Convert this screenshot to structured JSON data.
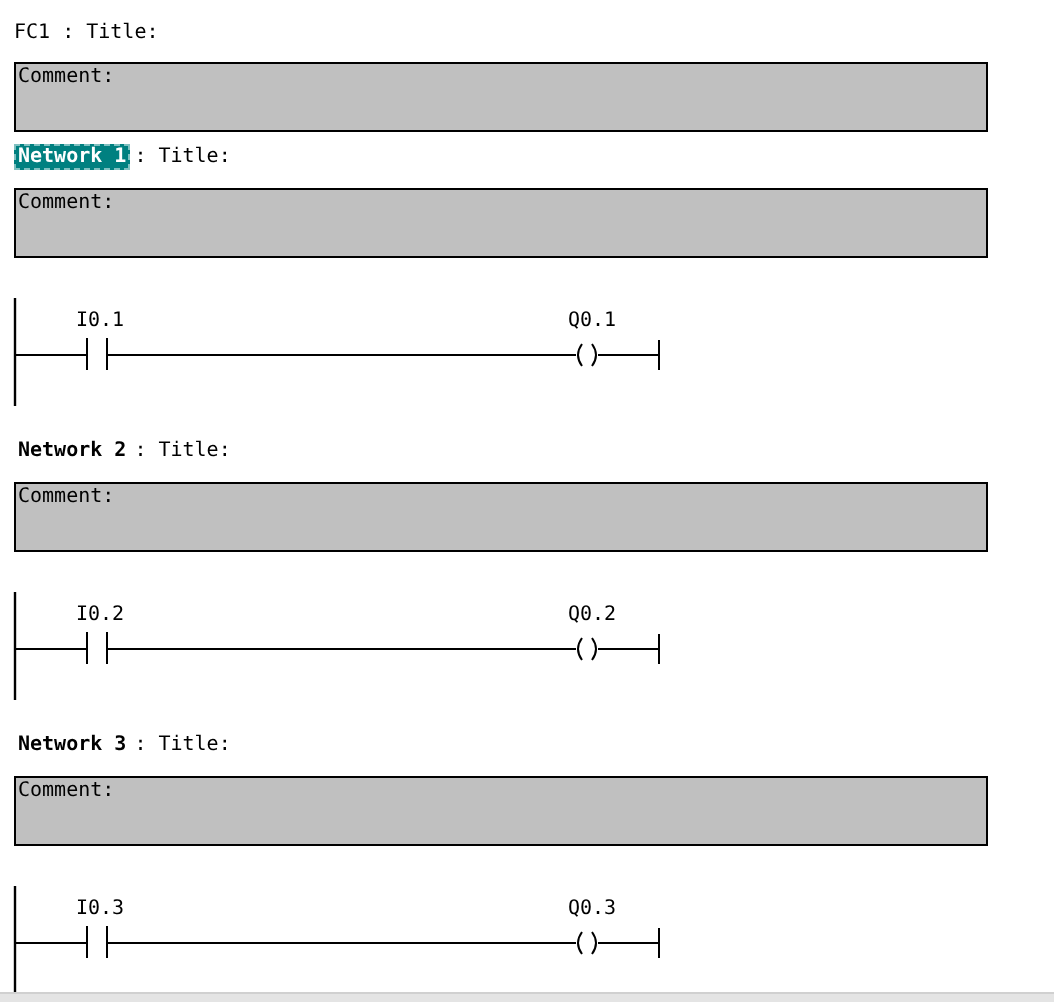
{
  "block": {
    "title": "FC1 : Title:",
    "comment": "Comment:"
  },
  "networks": [
    {
      "label": "Network 1",
      "selected": true,
      "title": ": Title:",
      "comment": "Comment:",
      "contact": "I0.1",
      "coil": "Q0.1"
    },
    {
      "label": "Network 2",
      "selected": false,
      "title": ": Title:",
      "comment": "Comment:",
      "contact": "I0.2",
      "coil": "Q0.2"
    },
    {
      "label": "Network 3",
      "selected": false,
      "title": ": Title:",
      "comment": "Comment:",
      "contact": "I0.3",
      "coil": "Q0.3"
    }
  ]
}
